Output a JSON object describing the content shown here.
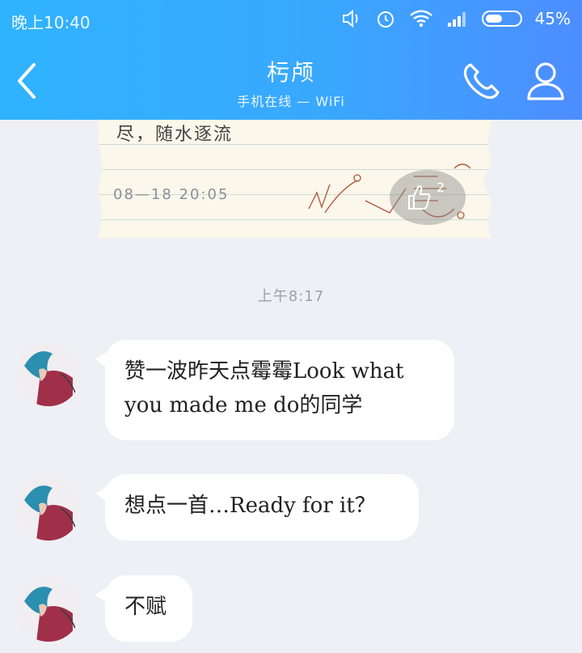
{
  "status_bar": {
    "time": "晚上10:40",
    "battery": "45%"
  },
  "header": {
    "title": "杇颅",
    "subtitle": "手机在线 — WiFi"
  },
  "previous_image": {
    "text": "尽，随水逐流",
    "date": "08—18 20:05",
    "like_count": "2"
  },
  "timestamp": "上午8:17",
  "messages": [
    {
      "text": "赞一波昨天点霉霉Look what you made me do的同学"
    },
    {
      "text": "想点一首…Ready for it？"
    },
    {
      "text": "不赋"
    }
  ],
  "colors": {
    "header_start": "#2fb3ff",
    "header_end": "#4d8dff",
    "bubble": "#ffffff",
    "page_bg": "#eef0f5"
  }
}
